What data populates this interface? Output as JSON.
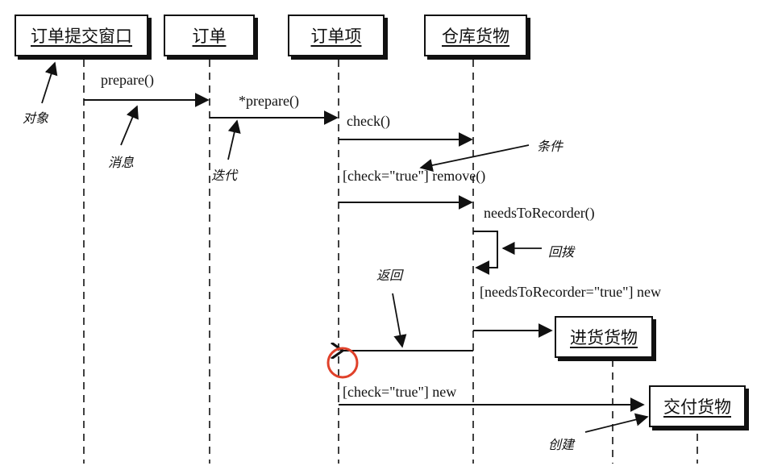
{
  "objects": {
    "order_submit_window": "订单提交窗口",
    "order": "订单",
    "order_item": "订单项",
    "warehouse_goods": "仓库货物",
    "restock_goods": "进货货物",
    "delivery_goods": "交付货物"
  },
  "messages": {
    "prepare": "prepare()",
    "star_prepare": "*prepare()",
    "check": "check()",
    "check_remove": "[check=\"true\"] remove()",
    "needs_to_recorder": "needsToRecorder()",
    "needs_new": "[needsToRecorder=\"true\"] new",
    "check_new": "[check=\"true\"] new"
  },
  "annotations": {
    "object": "对象",
    "message": "消息",
    "iteration": "迭代",
    "condition": "条件",
    "self_call": "回拨",
    "return": "返回",
    "create": "创建"
  },
  "colors": {
    "line": "#111111",
    "highlight": "#e0412a"
  }
}
